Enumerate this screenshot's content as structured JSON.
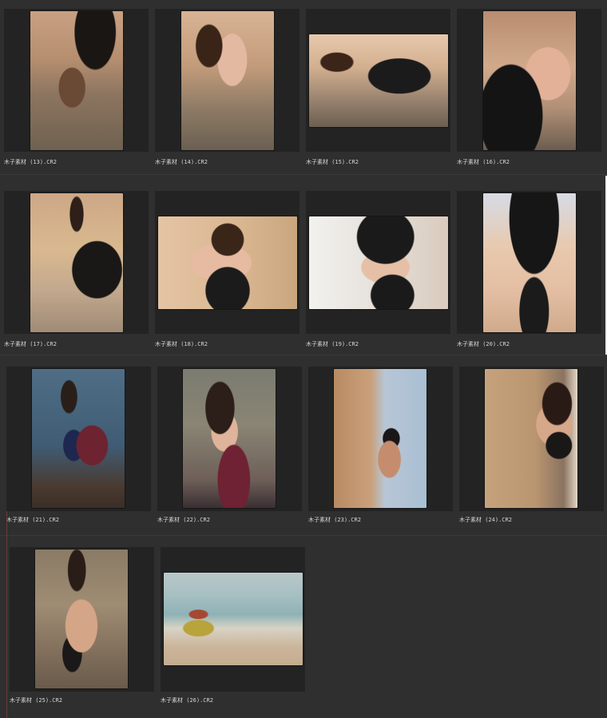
{
  "thumbnails": [
    {
      "caption": "木子素材 (13).CR2"
    },
    {
      "caption": "木子素材 (14).CR2"
    },
    {
      "caption": "木子素材 (15).CR2"
    },
    {
      "caption": "木子素材 (16).CR2"
    },
    {
      "caption": "木子素材 (17).CR2"
    },
    {
      "caption": "木子素材 (18).CR2"
    },
    {
      "caption": "木子素材 (19).CR2"
    },
    {
      "caption": "木子素材 (20).CR2"
    },
    {
      "caption": "木子素材 (21).CR2"
    },
    {
      "caption": "木子素材 (22).CR2"
    },
    {
      "caption": "木子素材 (23).CR2"
    },
    {
      "caption": "木子素材 (24).CR2"
    },
    {
      "caption": "木子素材 (25).CR2"
    },
    {
      "caption": "木子素材 (26).CR2"
    }
  ]
}
